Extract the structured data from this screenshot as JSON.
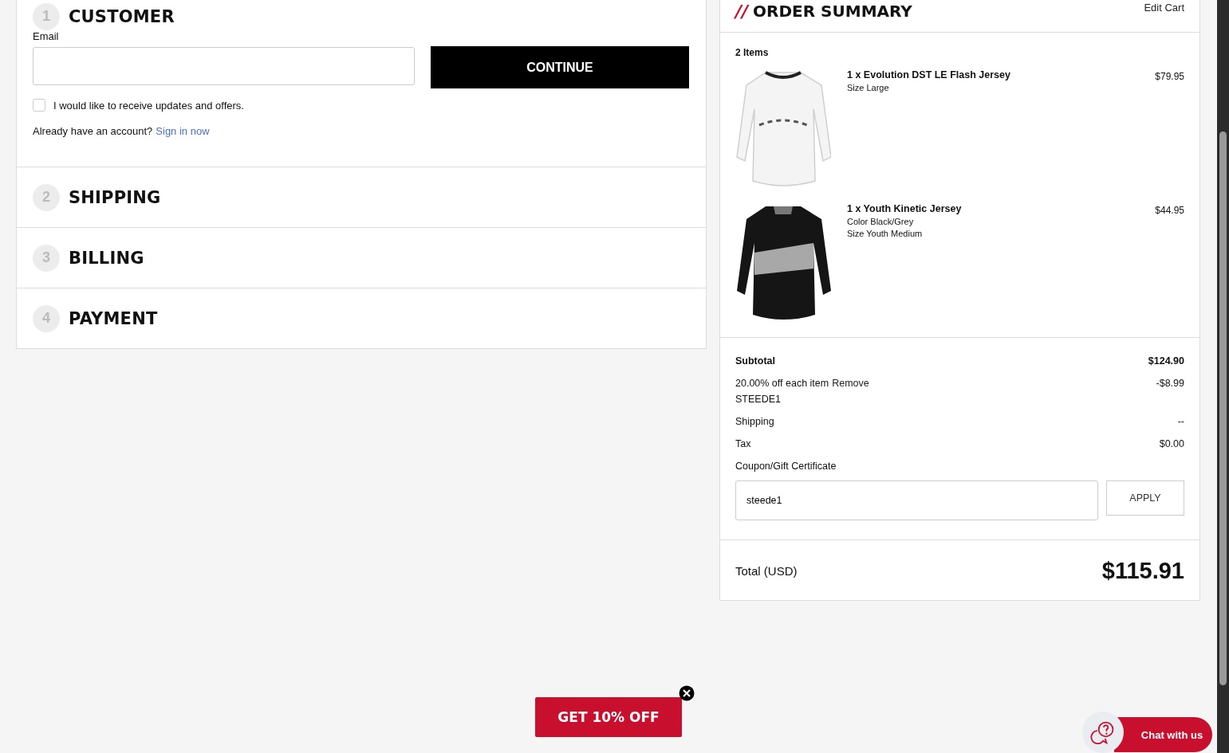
{
  "checkout_steps": [
    {
      "number": "1",
      "title": "CUSTOMER"
    },
    {
      "number": "2",
      "title": "SHIPPING"
    },
    {
      "number": "3",
      "title": "BILLING"
    },
    {
      "number": "4",
      "title": "PAYMENT"
    }
  ],
  "customer": {
    "email_label": "Email",
    "continue_button": "CONTINUE",
    "newsletter": {
      "label": "I would like to receive updates and offers.",
      "checked": false
    },
    "account_prompt": "Already have an account?",
    "sign_in_link": "Sign in now"
  },
  "order_summary": {
    "title_mark": "//",
    "title": "ORDER SUMMARY",
    "edit_link": "Edit Cart",
    "items_count": "2 Items",
    "items": [
      {
        "name": "1 x Evolution DST LE Flash Jersey",
        "details": [
          "Size Large"
        ],
        "price": "$79.95",
        "kind": "white"
      },
      {
        "name": "1 x Youth Kinetic Jersey",
        "details": [
          "Color Black/Grey",
          "Size Youth Medium"
        ],
        "price": "$44.95",
        "kind": "black"
      }
    ],
    "subtotal": {
      "label": "Subtotal",
      "value": "$124.90"
    },
    "discount": {
      "label": "20.00% off each item",
      "remove_link": "Remove",
      "code": "STEEDE1",
      "value": "-$8.99"
    },
    "lines": [
      {
        "label": "Shipping",
        "value": "--"
      },
      {
        "label": "Tax",
        "value": "$0.00"
      }
    ],
    "coupon": {
      "label": "Coupon/Gift Certificate",
      "value": "steede1",
      "apply_button": "APPLY"
    },
    "total": {
      "label": "Total (USD)",
      "value": "$115.91"
    }
  },
  "promo_button": "GET 10% OFF",
  "chat_button": "Chat with us"
}
